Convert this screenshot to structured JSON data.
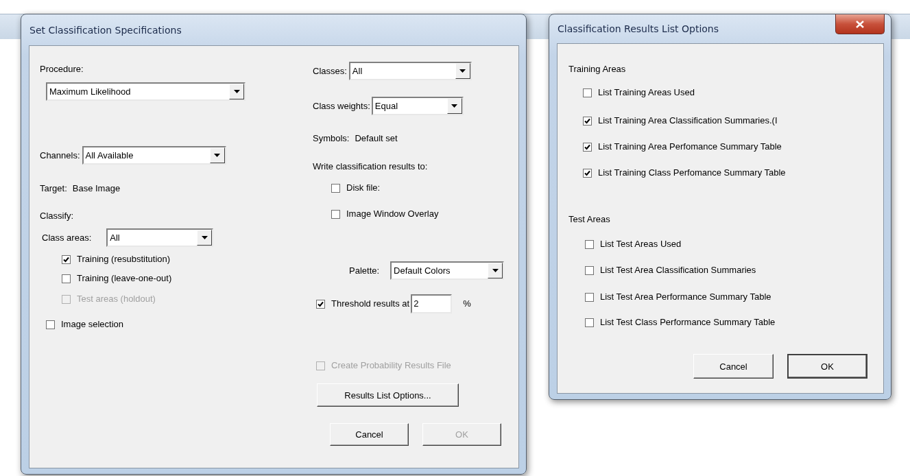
{
  "classification_dialog": {
    "title": "Set Classification Specifications",
    "procedure": {
      "label": "Procedure:",
      "value": "Maximum Likelihood"
    },
    "channels": {
      "label": "Channels:",
      "value": "All Available"
    },
    "target": {
      "label": "Target:",
      "value": "Base Image"
    },
    "classify": {
      "label": "Classify:",
      "class_areas": {
        "label": "Class areas:",
        "value": "All"
      },
      "options": [
        {
          "label": "Training (resubstitution)",
          "checked": true,
          "disabled": false
        },
        {
          "label": "Training (leave-one-out)",
          "checked": false,
          "disabled": false
        },
        {
          "label": "Test areas (holdout)",
          "checked": false,
          "disabled": true
        }
      ]
    },
    "image_selection": {
      "label": "Image selection",
      "checked": false
    },
    "classes": {
      "label": "Classes:",
      "value": "All"
    },
    "class_weights": {
      "label": "Class weights:",
      "value": "Equal"
    },
    "symbols": {
      "label": "Symbols:",
      "value": "Default set"
    },
    "write_results": {
      "label": "Write classification results to:",
      "options": [
        {
          "label": "Disk file:",
          "checked": false
        },
        {
          "label": "Image Window Overlay",
          "checked": false
        }
      ]
    },
    "palette": {
      "label": "Palette:",
      "value": "Default Colors"
    },
    "threshold": {
      "label": "Threshold results at",
      "checked": true,
      "value": "2",
      "unit": "%"
    },
    "probability_file": {
      "label": "Create Probability Results File",
      "checked": false,
      "disabled": true
    },
    "results_button": "Results List Options...",
    "buttons": [
      {
        "label": "Cancel",
        "disabled": false
      },
      {
        "label": "OK",
        "disabled": true
      }
    ]
  },
  "results_list_dialog": {
    "title": "Classification Results List Options",
    "sections": [
      {
        "heading": "Training Areas",
        "options": [
          {
            "label": "List Training Areas Used",
            "checked": false
          },
          {
            "label": "List Training Area Classification Summaries.(I",
            "checked": true
          },
          {
            "label": "List Training Area Perfomance Summary Table",
            "checked": true
          },
          {
            "label": "List Training Class Perfomance Summary Table",
            "checked": true
          }
        ]
      },
      {
        "heading": "Test Areas",
        "options": [
          {
            "label": "List Test Areas Used",
            "checked": false
          },
          {
            "label": "List Test Area Classification Summaries",
            "checked": false
          },
          {
            "label": "List Test Area Performance Summary Table",
            "checked": false
          },
          {
            "label": "List Test Class Performance Summary Table",
            "checked": false
          }
        ]
      }
    ],
    "buttons": [
      {
        "label": "Cancel",
        "disabled": false
      },
      {
        "label": "OK",
        "disabled": false
      }
    ]
  }
}
